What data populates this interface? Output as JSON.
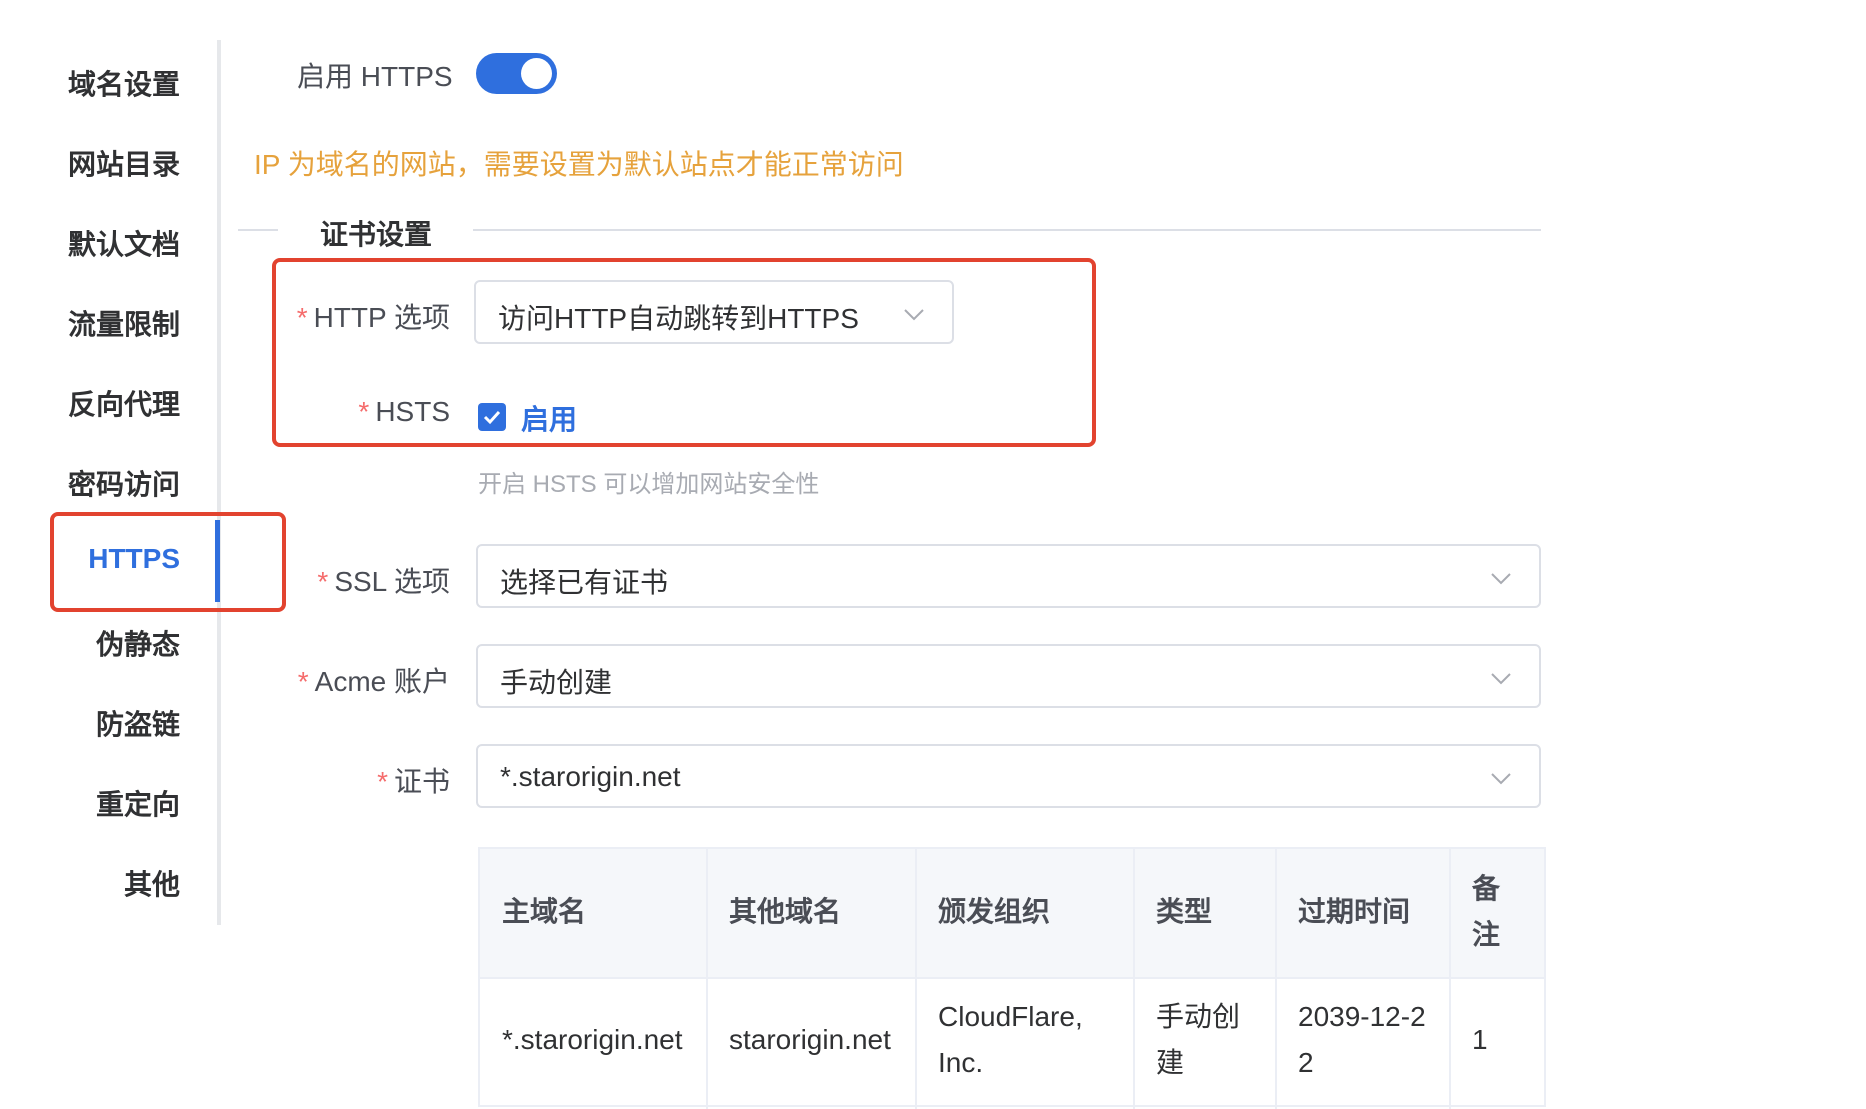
{
  "sidebar": {
    "items": [
      {
        "label": "域名设置"
      },
      {
        "label": "网站目录"
      },
      {
        "label": "默认文档"
      },
      {
        "label": "流量限制"
      },
      {
        "label": "反向代理"
      },
      {
        "label": "密码访问"
      },
      {
        "label": "HTTPS",
        "active": true
      },
      {
        "label": "伪静态"
      },
      {
        "label": "防盗链"
      },
      {
        "label": "重定向"
      },
      {
        "label": "其他"
      }
    ]
  },
  "form": {
    "enable_https_label": "启用 HTTPS",
    "enable_https_on": true,
    "ip_warning": "IP 为域名的网站，需要设置为默认站点才能正常访问",
    "cert_section_title": "证书设置",
    "http_option": {
      "label": "HTTP 选项",
      "value": "访问HTTP自动跳转到HTTPS"
    },
    "hsts": {
      "label": "HSTS",
      "checkbox_label": "启用",
      "checked": true,
      "hint": "开启 HSTS 可以增加网站安全性"
    },
    "ssl_option": {
      "label": "SSL 选项",
      "value": "选择已有证书"
    },
    "acme_account": {
      "label": "Acme 账户",
      "value": "手动创建"
    },
    "certificate": {
      "label": "证书",
      "value": "*.starorigin.net"
    },
    "required_mark": "*"
  },
  "cert_table": {
    "headers": [
      "主域名",
      "其他域名",
      "颁发组织",
      "类型",
      "过期时间",
      "备注"
    ],
    "rows": [
      [
        "*.starorigin.net",
        "starorigin.net",
        "CloudFlare, Inc.",
        "手动创建",
        "2039-12-22",
        "1"
      ]
    ]
  },
  "colors": {
    "accent": "#2f6fde",
    "warning": "#e6a23c",
    "highlight_box": "#e2432f",
    "required": "#f56c6c"
  }
}
